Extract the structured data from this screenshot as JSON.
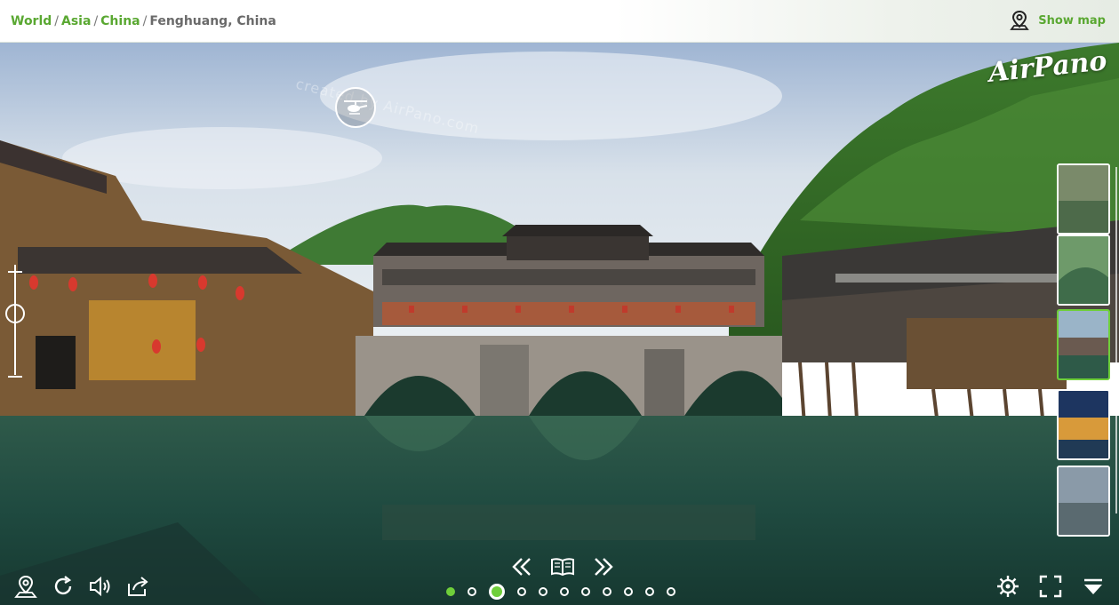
{
  "breadcrumb": {
    "items": [
      "World",
      "Asia",
      "China"
    ],
    "separator": "/",
    "current": "Fenghuang, China"
  },
  "header": {
    "show_map_label": "Show map"
  },
  "pano": {
    "watermark": "created by AirPano.com",
    "logo": "AirPano"
  },
  "thumbnails": {
    "active_index": 2,
    "count": 5
  },
  "pagination": {
    "count": 11,
    "active_index": 2
  },
  "colors": {
    "accent": "#6fcf3a",
    "link": "#5aa832"
  },
  "icons": {
    "map": "map-pin-icon",
    "helicopter": "helicopter-icon",
    "zoom_in": "plus-icon",
    "zoom_out": "minus-icon",
    "location": "location-pin-icon",
    "rotate": "rotate-icon",
    "sound": "speaker-icon",
    "share": "share-icon",
    "prev": "double-chevron-left-icon",
    "book": "book-icon",
    "next": "double-chevron-right-icon",
    "settings": "gear-icon",
    "fullscreen": "fullscreen-icon",
    "collapse": "collapse-down-icon"
  }
}
